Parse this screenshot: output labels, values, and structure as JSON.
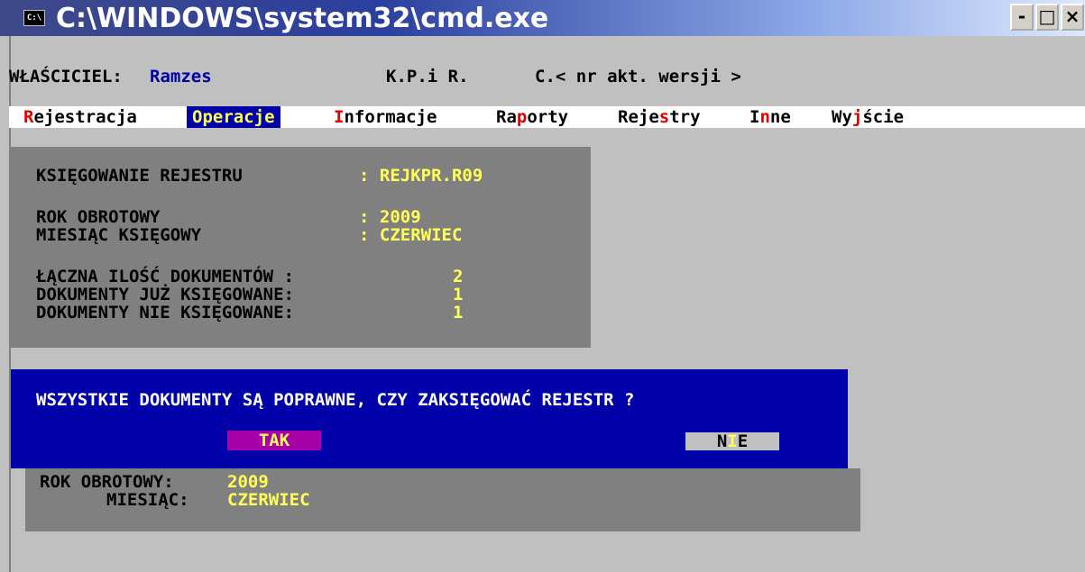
{
  "window": {
    "title": "C:\\WINDOWS\\system32\\cmd.exe",
    "icon": "C:\\",
    "controls": {
      "minimize": "-",
      "maximize": "□",
      "close": "×"
    }
  },
  "header": {
    "owner_label": "WŁAŚCICIEL:",
    "owner_value": "Ramzes",
    "app_name": "K.P.i R.",
    "version": "C.< nr akt. wersji >"
  },
  "menu": [
    {
      "hotkey": "R",
      "rest": "ejestracja",
      "pre": ""
    },
    {
      "hotkey": "",
      "rest": "Operacje",
      "pre": ""
    },
    {
      "hotkey": "I",
      "rest": "nformacje",
      "pre": ""
    },
    {
      "pre": "Ra",
      "hotkey": "p",
      "rest": "orty"
    },
    {
      "pre": "Reje",
      "hotkey": "s",
      "rest": "try"
    },
    {
      "pre": "I",
      "hotkey": "n",
      "rest": "ne"
    },
    {
      "pre": "Wy",
      "hotkey": "j",
      "rest": "ście"
    }
  ],
  "active_menu": "Operacje",
  "panel": {
    "register_label": "KSIĘGOWANIE REJESTRU",
    "register_value": ": REJKPR.R09",
    "year_label": "ROK OBROTOWY",
    "year_value": ": 2009",
    "month_label": "MIESIĄC KSIĘGOWY",
    "month_value": ": CZERWIEC",
    "total_label": "ŁĄCZNA ILOŚĆ DOKUMENTÓW :",
    "total_value": "2",
    "posted_label": "DOKUMENTY JUŻ KSIĘGOWANE:",
    "posted_value": "1",
    "unposted_label": "DOKUMENTY NIE KSIĘGOWANE:",
    "unposted_value": "1"
  },
  "dialog": {
    "question": "WSZYSTKIE DOKUMENTY SĄ POPRAWNE, CZY ZAKSIĘGOWAĆ REJESTR ?",
    "yes": "TAK",
    "no_first": "N",
    "no_hotkey": "I",
    "no_rest": "E"
  },
  "lower_panel": {
    "year_label": "ROK OBROTOWY:",
    "year_value": "2009",
    "month_label": "MIESIĄC:",
    "month_value": "CZERWIEC"
  },
  "colors": {
    "console_bg": "#c0c0c0",
    "panel_bg": "#808080",
    "dialog_bg": "#0000a8",
    "value_yellow": "#ffff55",
    "hotkey_red": "#e00000",
    "tak_button": "#a800a8"
  }
}
